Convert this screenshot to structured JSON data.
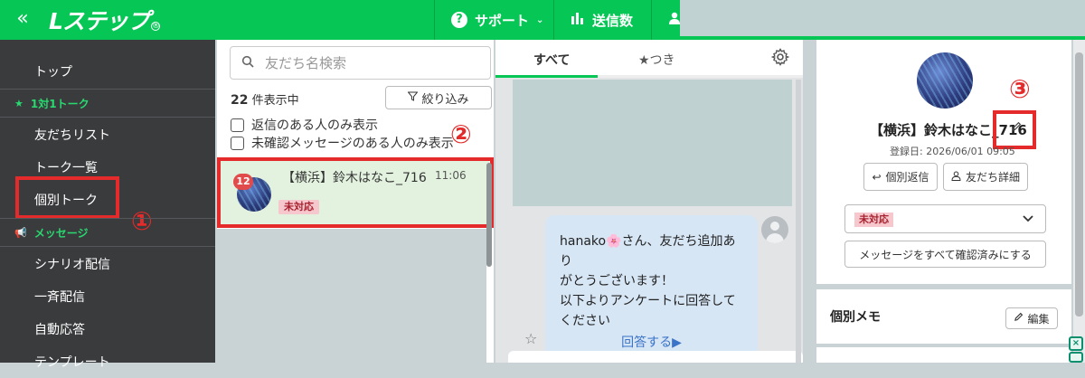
{
  "header": {
    "collapse_icon": "«",
    "logo_text": "Lステップ",
    "help_label": "サポート",
    "send_count_label": "送信数"
  },
  "sidebar": {
    "items": [
      {
        "label": "トップ"
      },
      {
        "label": "友だちリスト"
      },
      {
        "label": "トーク一覧"
      },
      {
        "label": "個別トーク"
      },
      {
        "label": "シナリオ配信"
      },
      {
        "label": "一斉配信"
      },
      {
        "label": "自動応答"
      },
      {
        "label": "テンプレート"
      }
    ],
    "sections": [
      {
        "label": "1対1トーク"
      },
      {
        "label": "メッセージ"
      }
    ]
  },
  "callouts": {
    "one": "①",
    "two": "②",
    "three": "③"
  },
  "friend_list": {
    "search_placeholder": "友だち名検索",
    "count_number": "22",
    "count_suffix": "件表示中",
    "filter_label": "絞り込み",
    "checkbox_replied": "返信のある人のみ表示",
    "checkbox_unread": "未確認メッセージのある人のみ表示",
    "rows": [
      {
        "name": "【横浜】鈴木はなこ_716",
        "time": "11:06",
        "badge": "12",
        "status": "未対応"
      }
    ]
  },
  "chat": {
    "tab_all": "すべて",
    "tab_starred": "★つき",
    "message_lines": [
      "hanako🌸さん、友だち追加あり",
      "がとうございます！",
      "以下よりアンケートに回答して",
      "ください"
    ],
    "answer_link": "回答する▶"
  },
  "profile": {
    "name": "【横浜】鈴木はなこ_716",
    "registered": "登録日: 2026/06/01 09:05",
    "reply_button": "個別返信",
    "detail_button": "友だち詳細",
    "status_value": "未対応",
    "mark_read_button": "メッセージをすべて確認済みにする",
    "memo_title": "個別メモ",
    "memo_edit": "編集"
  },
  "colors": {
    "brand_green": "#06c755",
    "sidebar_bg": "#3a3b3d",
    "highlight_red": "#e42a2a",
    "status_tag_bg": "#f6c7cd"
  }
}
